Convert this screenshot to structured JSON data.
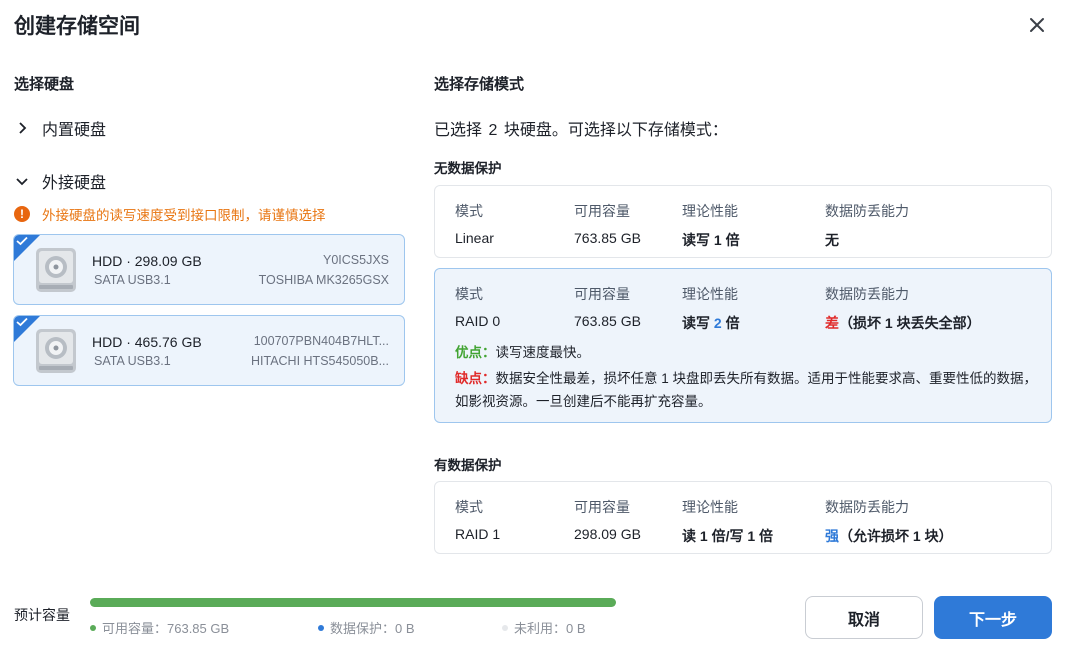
{
  "dialog": {
    "title": "创建存储空间"
  },
  "left": {
    "heading": "选择硬盘",
    "internal_label": "内置硬盘",
    "external_label": "外接硬盘",
    "warning": "外接硬盘的读写速度受到接口限制，请谨慎选择",
    "disks": [
      {
        "name": "HDD · 298.09 GB",
        "interface": "SATA USB3.1",
        "serial": "Y0ICS5JXS",
        "model": "TOSHIBA MK3265GSX",
        "selected": true
      },
      {
        "name": "HDD · 465.76 GB",
        "interface": "SATA USB3.1",
        "serial": "100707PBN404B7HLT...",
        "model": "HITACHI HTS545050B...",
        "selected": true
      }
    ]
  },
  "right": {
    "heading": "选择存储模式",
    "summary_pre": "已选择",
    "summary_num": "2",
    "summary_post": "块硬盘。可选择以下存储模式：",
    "no_protection_heading": "无数据保护",
    "protection_heading": "有数据保护",
    "columns": {
      "mode": "模式",
      "capacity": "可用容量",
      "perf": "理论性能",
      "safety": "数据防丢能力"
    },
    "linear": {
      "mode": "Linear",
      "capacity": "763.85 GB",
      "perf": "读写 1 倍",
      "safety": "无"
    },
    "raid0": {
      "mode": "RAID 0",
      "capacity": "763.85 GB",
      "perf_pre": "读写",
      "perf_num": "2",
      "perf_post": "倍",
      "safety_main": "差",
      "safety_note": "（损坏 1 块丢失全部）",
      "pro_label": "优点：",
      "pro_text": "读写速度最快。",
      "con_label": "缺点：",
      "con_text": "数据安全性最差，损坏任意 1 块盘即丢失所有数据。适用于性能要求高、重要性低的数据，如影视资源。一旦创建后不能再扩充容量。"
    },
    "raid1": {
      "mode": "RAID 1",
      "capacity": "298.09 GB",
      "perf": "读 1 倍/写 1 倍",
      "safety_main": "强",
      "safety_note": "（允许损坏 1 块）"
    }
  },
  "footer": {
    "label": "预计容量",
    "legend": [
      {
        "text": "可用容量：763.85 GB",
        "color": "#5aab58"
      },
      {
        "text": "数据保护：0 B",
        "color": "#2f7ad8"
      },
      {
        "text": "未利用：0 B",
        "color": "#e6e8eb"
      }
    ],
    "usable_fraction": 1.0,
    "cancel_label": "取消",
    "next_label": "下一步"
  },
  "colors": {
    "accent": "#2f7ad8",
    "warning": "#e87511",
    "danger": "#e02a2a",
    "success": "#42a433"
  }
}
